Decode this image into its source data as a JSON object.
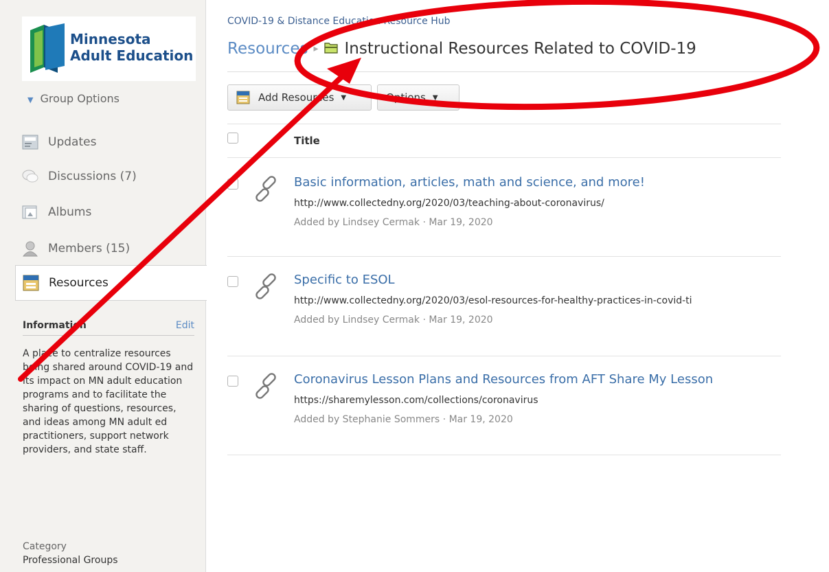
{
  "sidebar": {
    "logo": {
      "line1": "Minnesota",
      "line2": "Adult Education"
    },
    "group_options": "Group Options",
    "nav": [
      {
        "label": "Updates",
        "icon": "updates-icon"
      },
      {
        "label": "Discussions (7)",
        "icon": "discussions-icon"
      },
      {
        "label": "Albums",
        "icon": "albums-icon"
      },
      {
        "label": "Members (15)",
        "icon": "members-icon"
      },
      {
        "label": "Resources",
        "icon": "resources-icon",
        "active": true
      }
    ],
    "information": {
      "heading": "Information",
      "edit": "Edit",
      "body": "A place to centralize resources being shared around COVID-19 and its impact on MN adult education programs and to facilitate the sharing of questions, resources, and ideas among MN adult ed practitioners, support network providers, and state staff.",
      "category_label": "Category",
      "category_value": "Professional Groups"
    }
  },
  "main": {
    "group_name": "COVID-19 & Distance Education Resource Hub",
    "breadcrumb_root": "Resources",
    "breadcrumb_separator": "▸",
    "folder_title": "Instructional Resources Related to COVID-19",
    "toolbar": {
      "add_label": "Add Resources",
      "options_label": "Options",
      "caret": "▼"
    },
    "list_header": "Title",
    "items": [
      {
        "title": "Basic information, articles, math and science, and more!",
        "url": "http://www.collectedny.org/2020/03/teaching-about-coronavirus/",
        "meta": "Added by Lindsey Cermak · Mar 19, 2020"
      },
      {
        "title": "Specific to ESOL",
        "url": "http://www.collectedny.org/2020/03/esol-resources-for-healthy-practices-in-covid-ti",
        "meta": "Added by Lindsey Cermak · Mar 19, 2020"
      },
      {
        "title": "Coronavirus Lesson Plans and Resources from AFT Share My Lesson",
        "url": "https://sharemylesson.com/collections/coronavirus",
        "meta": "Added by Stephanie Sommers · Mar 19, 2020"
      }
    ]
  },
  "colors": {
    "accent_link": "#3a6ea8",
    "annotation_red": "#e8000b",
    "sidebar_bg": "#f3f2ef"
  }
}
